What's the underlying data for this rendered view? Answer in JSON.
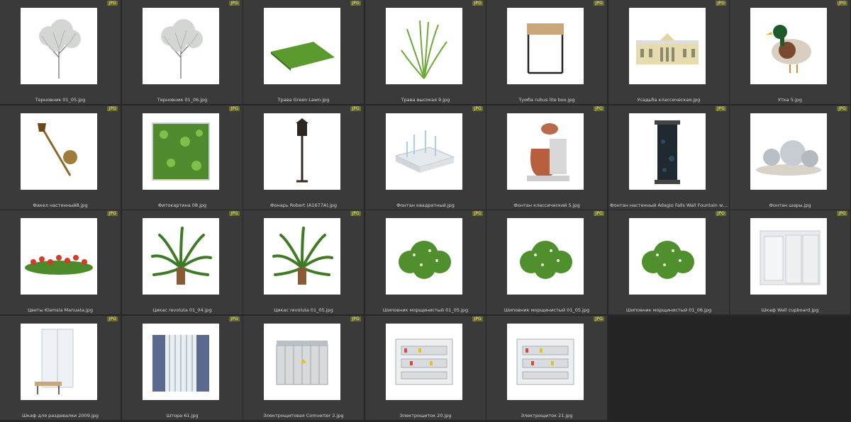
{
  "badge": "JPG",
  "thumbnails": [
    {
      "label": "Терновник 01_05.jpg",
      "icon": "tree-icon"
    },
    {
      "label": "Терновник 01_06.jpg",
      "icon": "tree-icon"
    },
    {
      "label": "Трава Green Lawn.jpg",
      "icon": "lawn-icon"
    },
    {
      "label": "Трава высокая 9.jpg",
      "icon": "grass-icon"
    },
    {
      "label": "Тумба rubus lite box.jpg",
      "icon": "stand-icon"
    },
    {
      "label": "Усадьба классическая.jpg",
      "icon": "building-icon"
    },
    {
      "label": "Утка 5.jpg",
      "icon": "duck-icon"
    },
    {
      "label": "Факел настенный8.jpg",
      "icon": "torch-icon"
    },
    {
      "label": "Фитокартина 08.jpg",
      "icon": "plant-panel-icon"
    },
    {
      "label": "Фонарь Robert (A1677A).jpg",
      "icon": "lamppost-icon"
    },
    {
      "label": "Фонтан квадратный.jpg",
      "icon": "fountain-icon"
    },
    {
      "label": "Фонтан классический 5.jpg",
      "icon": "vase-fountain-icon"
    },
    {
      "label": "Фонтан настенный Adagio Falls Wall Fountain with Marble...",
      "icon": "wall-fountain-icon"
    },
    {
      "label": "Фонтан шары.jpg",
      "icon": "spheres-icon"
    },
    {
      "label": "Цветы Klamsia Manuata.jpg",
      "icon": "flowers-icon"
    },
    {
      "label": "Цикас revoluta 01_04.jpg",
      "icon": "palm-icon"
    },
    {
      "label": "Цикас revoluta 01_05.jpg",
      "icon": "palm-icon"
    },
    {
      "label": "Шиповник морщинистый 01_05.jpg",
      "icon": "bush-icon"
    },
    {
      "label": "Шиповник морщинистый 01_05.jpg",
      "icon": "bush-icon"
    },
    {
      "label": "Шиповник морщинистый 01_06.jpg",
      "icon": "bush-icon"
    },
    {
      "label": "Шкаф Wall cupboard.jpg",
      "icon": "cupboard-icon"
    },
    {
      "label": "Шкаф для раздевалки 2009.jpg",
      "icon": "locker-icon"
    },
    {
      "label": "Штора 61.jpg",
      "icon": "curtain-icon"
    },
    {
      "label": "Электрощитовая Comverter 2.jpg",
      "icon": "substation-icon"
    },
    {
      "label": "Электрощиток 20.jpg",
      "icon": "panel-icon"
    },
    {
      "label": "Электрощиток 21.jpg",
      "icon": "panel-icon"
    }
  ]
}
